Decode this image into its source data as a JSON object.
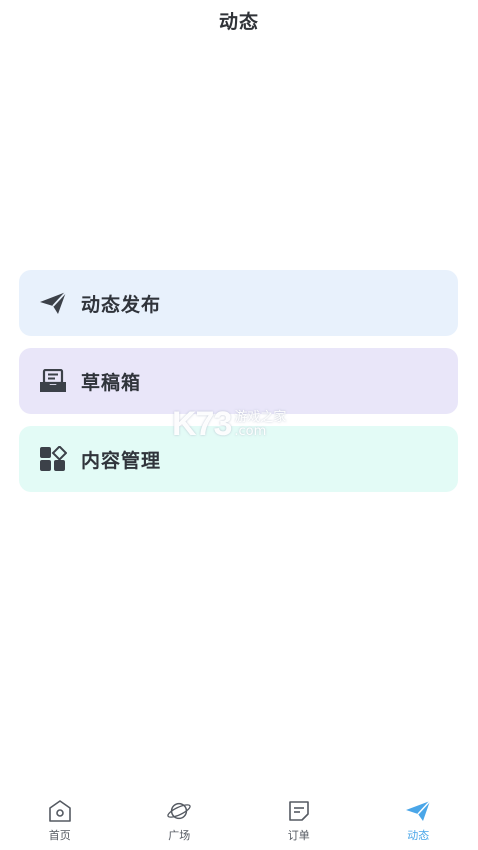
{
  "header": {
    "title": "动态"
  },
  "menu": {
    "items": [
      {
        "label": "动态发布",
        "icon": "paper-plane-icon",
        "bg": "#e8f1fc"
      },
      {
        "label": "草稿箱",
        "icon": "inbox-tray-icon",
        "bg": "#e9e6f9"
      },
      {
        "label": "内容管理",
        "icon": "grid-apps-icon",
        "bg": "#e3fbf6"
      }
    ]
  },
  "watermark": {
    "big": "K73",
    "cn": "游戏之家",
    "com": ".com"
  },
  "tabbar": {
    "active_color": "#4aa6e8",
    "tabs": [
      {
        "label": "首页",
        "icon": "home-icon"
      },
      {
        "label": "广场",
        "icon": "planet-icon"
      },
      {
        "label": "订单",
        "icon": "order-icon"
      },
      {
        "label": "动态",
        "icon": "paper-plane-icon",
        "active": true
      }
    ]
  }
}
